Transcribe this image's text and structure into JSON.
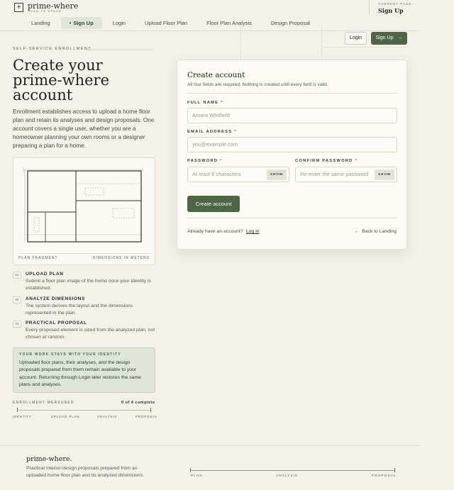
{
  "brand": {
    "name": "prime-where",
    "tagline": "PLAN TO SPACE",
    "logo_glyph": "+"
  },
  "current_page": {
    "label": "CURRENT PAGE",
    "value": "Sign Up"
  },
  "nav": {
    "items": [
      {
        "label": "Landing"
      },
      {
        "label": "Sign Up",
        "active": true
      },
      {
        "label": "Login"
      },
      {
        "label": "Upload Floor Plan"
      },
      {
        "label": "Floor Plan Analysis"
      },
      {
        "label": "Design Proposal"
      }
    ],
    "active_marker": "•"
  },
  "header_buttons": {
    "login": "Login",
    "signup": "Sign Up",
    "signup_arrow": "→"
  },
  "hero": {
    "eyebrow": "SELF-SERVICE ENROLLMENT",
    "title": "Create your prime-where account",
    "body": "Enrollment establishes access to upload a home floor plan and retain its analyses and design proposals. One account covers a single user, whether you are a homeowner planning your own rooms or a designer preparing a plan for a home."
  },
  "plan_card": {
    "label": "PLAN FRAGMENT",
    "dimensions": "DIMENSIONS IN METERS"
  },
  "steps": [
    {
      "num": "01",
      "title": "UPLOAD PLAN",
      "desc": "Submit a floor plan image of the home once your identity is established."
    },
    {
      "num": "02",
      "title": "ANALYZE DIMENSIONS",
      "desc": "The system derives the layout and the dimensions represented in the plan."
    },
    {
      "num": "03",
      "title": "PRACTICAL PROPOSAL",
      "desc": "Every proposed element is sized from the analyzed plan, not chosen at random."
    }
  ],
  "identity": {
    "heading": "YOUR WORK STAYS WITH YOUR IDENTITY",
    "body": "Uploaded floor plans, their analyses, and the design proposals prepared from them remain available to your account. Returning through Login later restores the same plans and analyses."
  },
  "measure": {
    "label": "ENROLLMENT MEASURED",
    "count": "0 of 4 complete",
    "completed": 0,
    "total": 4,
    "stages": [
      "IDENTITY",
      "UPLOAD PLAN",
      "ANALYSIS",
      "PROPOSAL"
    ]
  },
  "form": {
    "title": "Create account",
    "subtitle": "All four fields are required. Nothing is created until every field is valid.",
    "required_mark": "*",
    "full_name": {
      "label": "FULL NAME",
      "placeholder": "Amara Whitfield",
      "value": ""
    },
    "email": {
      "label": "EMAIL ADDRESS",
      "placeholder": "you@example.com",
      "value": ""
    },
    "password": {
      "label": "PASSWORD",
      "placeholder": "At least 8 characters",
      "value": "",
      "toggle": "SHOW"
    },
    "confirm": {
      "label": "CONFIRM PASSWORD",
      "placeholder": "Re-enter the same password",
      "value": "",
      "toggle": "SHOW"
    },
    "submit": "Create account",
    "already": "Already have an account?",
    "login_link": "Log in",
    "back_arrow": "←",
    "back_link": "Back to Landing"
  },
  "footer": {
    "brand": "prime-where.",
    "text": "Practical interior-design proposals prepared from an uploaded home floor plan and its analyzed dimensions.",
    "stages": [
      "PLAN",
      "ANALYSIS",
      "PROPOSAL"
    ]
  },
  "colors": {
    "background": "#f3f1e8",
    "accent_green": "#4e6547",
    "active_tab": "#dfe6d8",
    "required": "#a5564b"
  }
}
